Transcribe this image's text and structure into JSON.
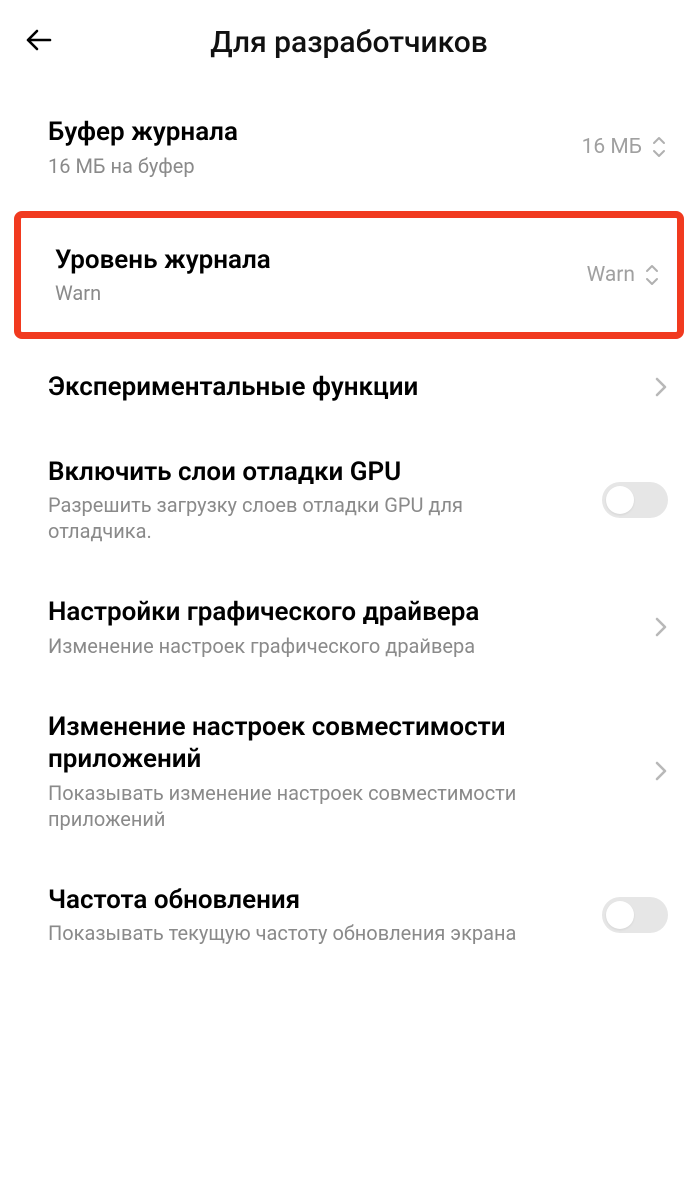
{
  "header": {
    "title": "Для разработчиков"
  },
  "rows": {
    "log_buffer": {
      "title": "Буфер журнала",
      "sub": "16 МБ на буфер",
      "value": "16 МБ"
    },
    "log_level": {
      "title": "Уровень журнала",
      "sub": "Warn",
      "value": "Warn"
    },
    "experimental": {
      "title": "Экспериментальные функции"
    },
    "gpu_debug": {
      "title": "Включить слои отладки GPU",
      "sub": "Разрешить загрузку слоев отладки GPU для отладчика."
    },
    "gpu_driver": {
      "title": "Настройки графического драйвера",
      "sub": "Изменение настроек графического драйвера"
    },
    "app_compat": {
      "title": "Изменение настроек совместимости приложений",
      "sub": "Показывать изменение настроек совместимости приложений"
    },
    "refresh_rate": {
      "title": "Частота обновления",
      "sub": "Показывать текущую частоту обновления экрана"
    }
  }
}
